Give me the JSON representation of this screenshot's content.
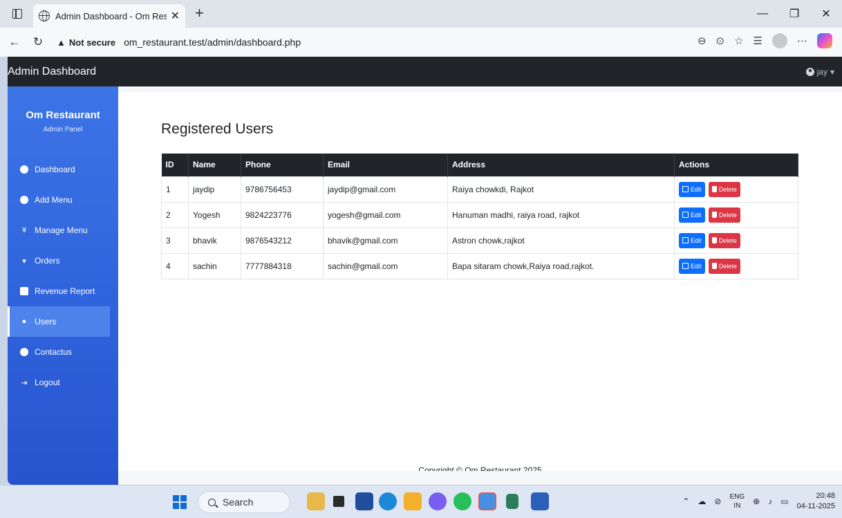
{
  "browser": {
    "tab_title": "Admin Dashboard - Om Restaura",
    "tab_close": "✕",
    "new_tab": "+",
    "security_label": "Not secure",
    "url": "om_restaurant.test/admin/dashboard.php",
    "controls": {
      "minimize": "—",
      "restore": "❐",
      "close": "✕"
    }
  },
  "topnav": {
    "brand": "Admin Dashboard",
    "user": "jay",
    "caret": "▾"
  },
  "sidebar": {
    "title": "Om Restaurant",
    "subtitle": "Admin Panel",
    "items": [
      {
        "label": "Dashboard",
        "icon": "gauge-icon",
        "active": false
      },
      {
        "label": "Add Menu",
        "icon": "plus-circle-icon",
        "active": false
      },
      {
        "label": "Manage Menu",
        "icon": "utensils-icon",
        "active": false
      },
      {
        "label": "Orders",
        "icon": "cart-icon",
        "active": false
      },
      {
        "label": "Revenue Report",
        "icon": "money-icon",
        "active": false
      },
      {
        "label": "Users",
        "icon": "users-icon",
        "active": true
      },
      {
        "label": "Contactus",
        "icon": "user-circle-icon",
        "active": false
      },
      {
        "label": "Logout",
        "icon": "logout-icon",
        "active": false
      }
    ]
  },
  "main": {
    "title": "Registered Users",
    "table": {
      "headers": [
        "ID",
        "Name",
        "Phone",
        "Email",
        "Address",
        "Actions"
      ],
      "rows": [
        {
          "id": "1",
          "name": "jaydip",
          "phone": "9786756453",
          "email": "jaydip@gmail.com",
          "address": "Raiya chowkdi, Rajkot"
        },
        {
          "id": "2",
          "name": "Yogesh",
          "phone": "9824223776",
          "email": "yogesh@gmail.com",
          "address": "Hanuman madhi, raiya road, rajkot"
        },
        {
          "id": "3",
          "name": "bhavik",
          "phone": "9876543212",
          "email": "bhavik@gmail.com",
          "address": "Astron chowk,rajkot"
        },
        {
          "id": "4",
          "name": "sachin",
          "phone": "7777884318",
          "email": "sachin@gmail.com",
          "address": "Bapa sitaram chowk,Raiya road,rajkot."
        }
      ],
      "edit_label": "Edit",
      "delete_label": "Delete"
    },
    "footer": "Copyright © Om Restaurant 2025"
  },
  "taskbar": {
    "search_label": "Search",
    "lang_top": "ENG",
    "lang_bottom": "IN",
    "time": "20:48",
    "date": "04-11-2025"
  },
  "colors": {
    "sidebar": "#2f63dc",
    "topnav": "#212529",
    "edit": "#0d6efd",
    "delete": "#dc3545"
  }
}
